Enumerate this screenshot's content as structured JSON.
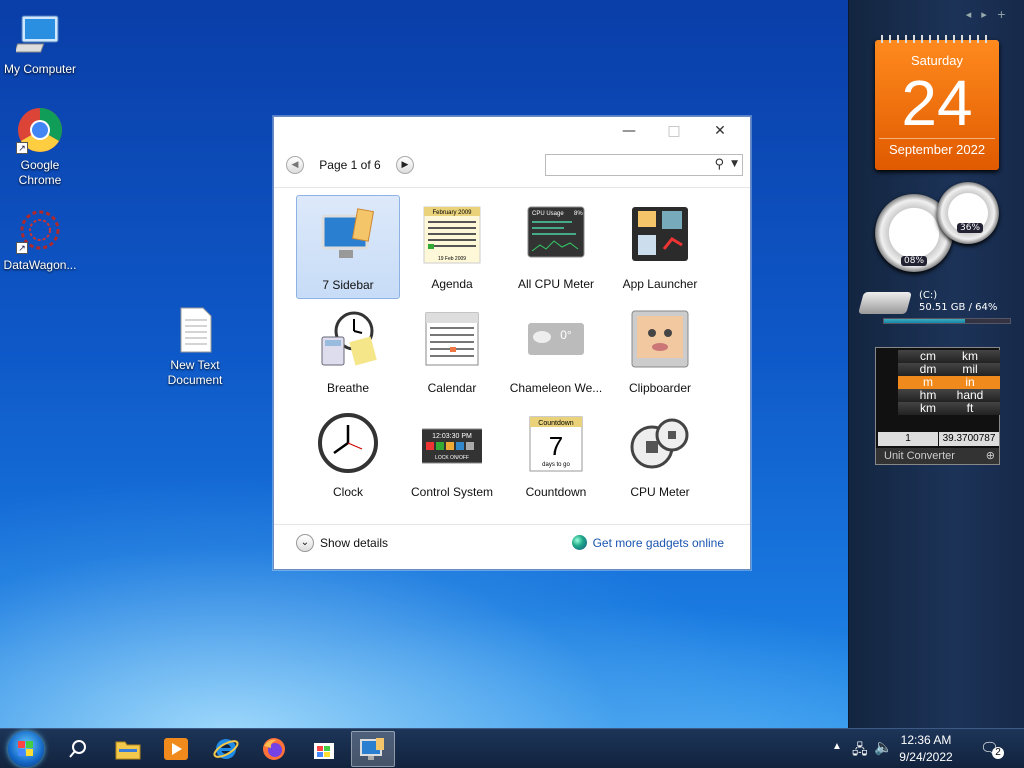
{
  "desktop": {
    "icons": [
      {
        "label": "My Computer"
      },
      {
        "label": "Google Chrome"
      },
      {
        "label": "DataWagon..."
      },
      {
        "label": "New Text Document"
      }
    ]
  },
  "sidebar": {
    "calendar": {
      "weekday": "Saturday",
      "day": "24",
      "month_year": "September 2022"
    },
    "cpu": {
      "cpu_usage": "08%",
      "ram_usage": "36%"
    },
    "drive": {
      "label": "(C:)",
      "info": "50.51 GB / 64%",
      "fill": 0.64
    },
    "unit_converter": {
      "left_units": [
        "cm",
        "dm",
        "m",
        "hm",
        "km"
      ],
      "right_units": [
        "km",
        "mil",
        "in",
        "hand",
        "ft"
      ],
      "left_selected": "m",
      "right_selected": "in",
      "input_value": "1",
      "output_value": "39.3700787",
      "title": "Unit Converter"
    }
  },
  "dialog": {
    "page_text": "Page 1 of 6",
    "search_placeholder": "",
    "gadgets": [
      {
        "label": "7 Sidebar",
        "icon": "sidebar-gadget-icon",
        "selected": true
      },
      {
        "label": "Agenda",
        "icon": "agenda-gadget-icon"
      },
      {
        "label": "All CPU Meter",
        "icon": "all-cpu-meter-icon"
      },
      {
        "label": "App Launcher",
        "icon": "app-launcher-icon"
      },
      {
        "label": "Breathe",
        "icon": "breathe-gadget-icon"
      },
      {
        "label": "Calendar",
        "icon": "calendar-gadget-icon"
      },
      {
        "label": "Chameleon We...",
        "icon": "chameleon-weather-icon"
      },
      {
        "label": "Clipboarder",
        "icon": "clipboarder-icon"
      },
      {
        "label": "Clock",
        "icon": "clock-gadget-icon"
      },
      {
        "label": "Control System",
        "icon": "control-system-icon"
      },
      {
        "label": "Countdown",
        "icon": "countdown-gadget-icon"
      },
      {
        "label": "CPU Meter",
        "icon": "cpu-meter-gadget-icon"
      }
    ],
    "agenda_icon_text": {
      "month": "February 2009",
      "footer": "19 Feb 2009"
    },
    "countdown_icon_text": {
      "title": "Countdown",
      "num": "7",
      "sub": "days to go"
    },
    "control_icon_text": {
      "time": "12:03:30 PM",
      "sub": "LOCK ON/OFF"
    },
    "cpu_icon_text": {
      "title": "CPU Usage",
      "pct": "8%"
    },
    "weather_icon_text": {
      "temp": "0°"
    },
    "show_details": "Show details",
    "get_more": "Get more gadgets online"
  },
  "taskbar": {
    "time": "12:36 AM",
    "date": "9/24/2022",
    "notifications": "2"
  },
  "colors": {
    "accent": "#1a55b0",
    "calendar": "#f07a12",
    "selected": "#c7dcf7"
  }
}
